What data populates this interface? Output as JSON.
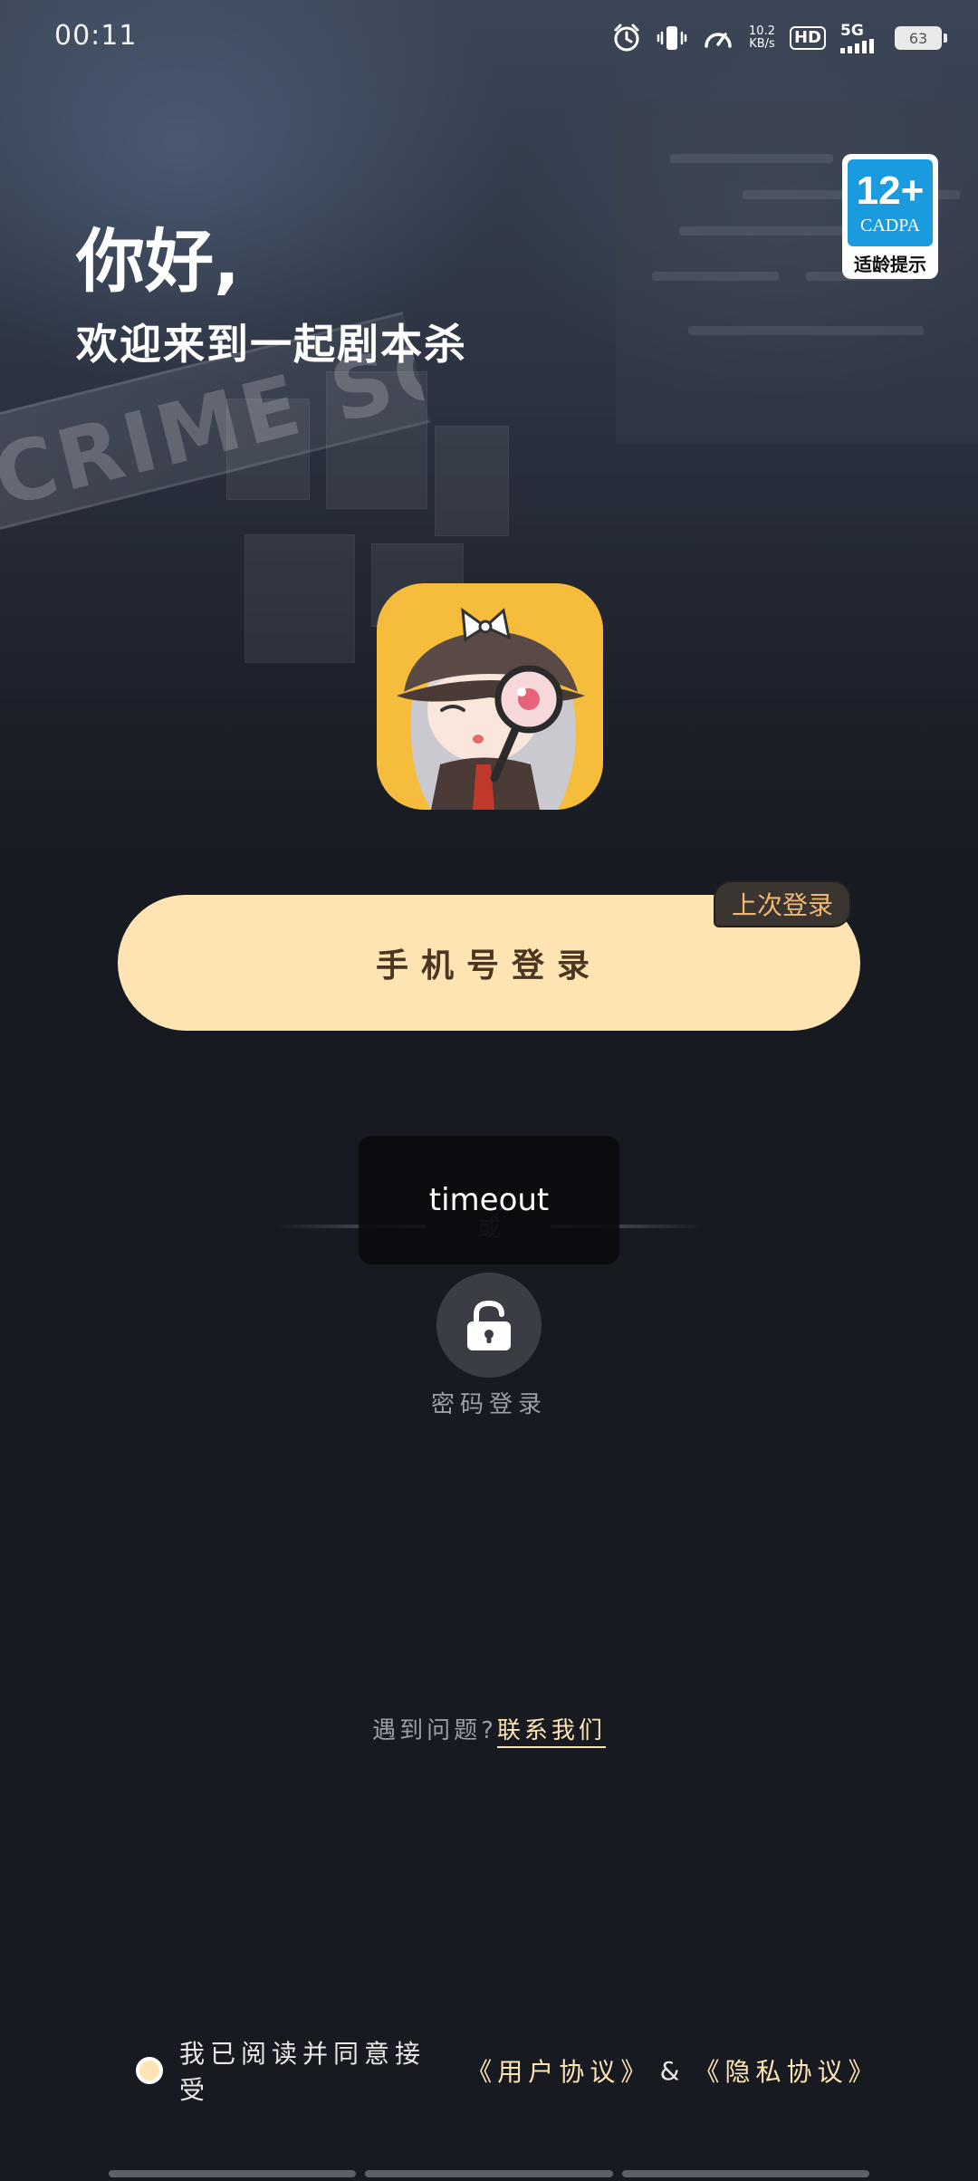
{
  "status_bar": {
    "time": "00:11",
    "net_speed_value": "10.2",
    "net_speed_unit": "KB/s",
    "hd": "HD",
    "network": "5G",
    "battery": "63",
    "icons": [
      "alarm-icon",
      "vibrate-icon",
      "speedometer-icon",
      "hd-icon",
      "signal-icon",
      "battery-icon"
    ]
  },
  "background": {
    "tape_text": "CRIME SCE"
  },
  "age_badge": {
    "rating": "12+",
    "org": "CADPA",
    "tip": "适龄提示"
  },
  "greeting": {
    "title": "你好,",
    "subtitle": "欢迎来到一起剧本杀"
  },
  "login": {
    "phone_label": "手机号登录",
    "last_login_tag": "上次登录",
    "or_text": "或",
    "password_label": "密码登录",
    "password_icon": "unlock-icon"
  },
  "toast": {
    "message": "timeout"
  },
  "help": {
    "question": "遇到问题?",
    "link": "联系我们"
  },
  "agreement": {
    "prefix": "我已阅读并同意接受",
    "user_agreement": "《用户协议》",
    "and": "&",
    "privacy_agreement": "《隐私协议》",
    "checked": true
  },
  "colors": {
    "background": "#171a21",
    "accent": "#fde4b2",
    "button_text": "#4a3621",
    "tag_text": "#f0b872",
    "logo_bg": "#f6bd3c"
  }
}
